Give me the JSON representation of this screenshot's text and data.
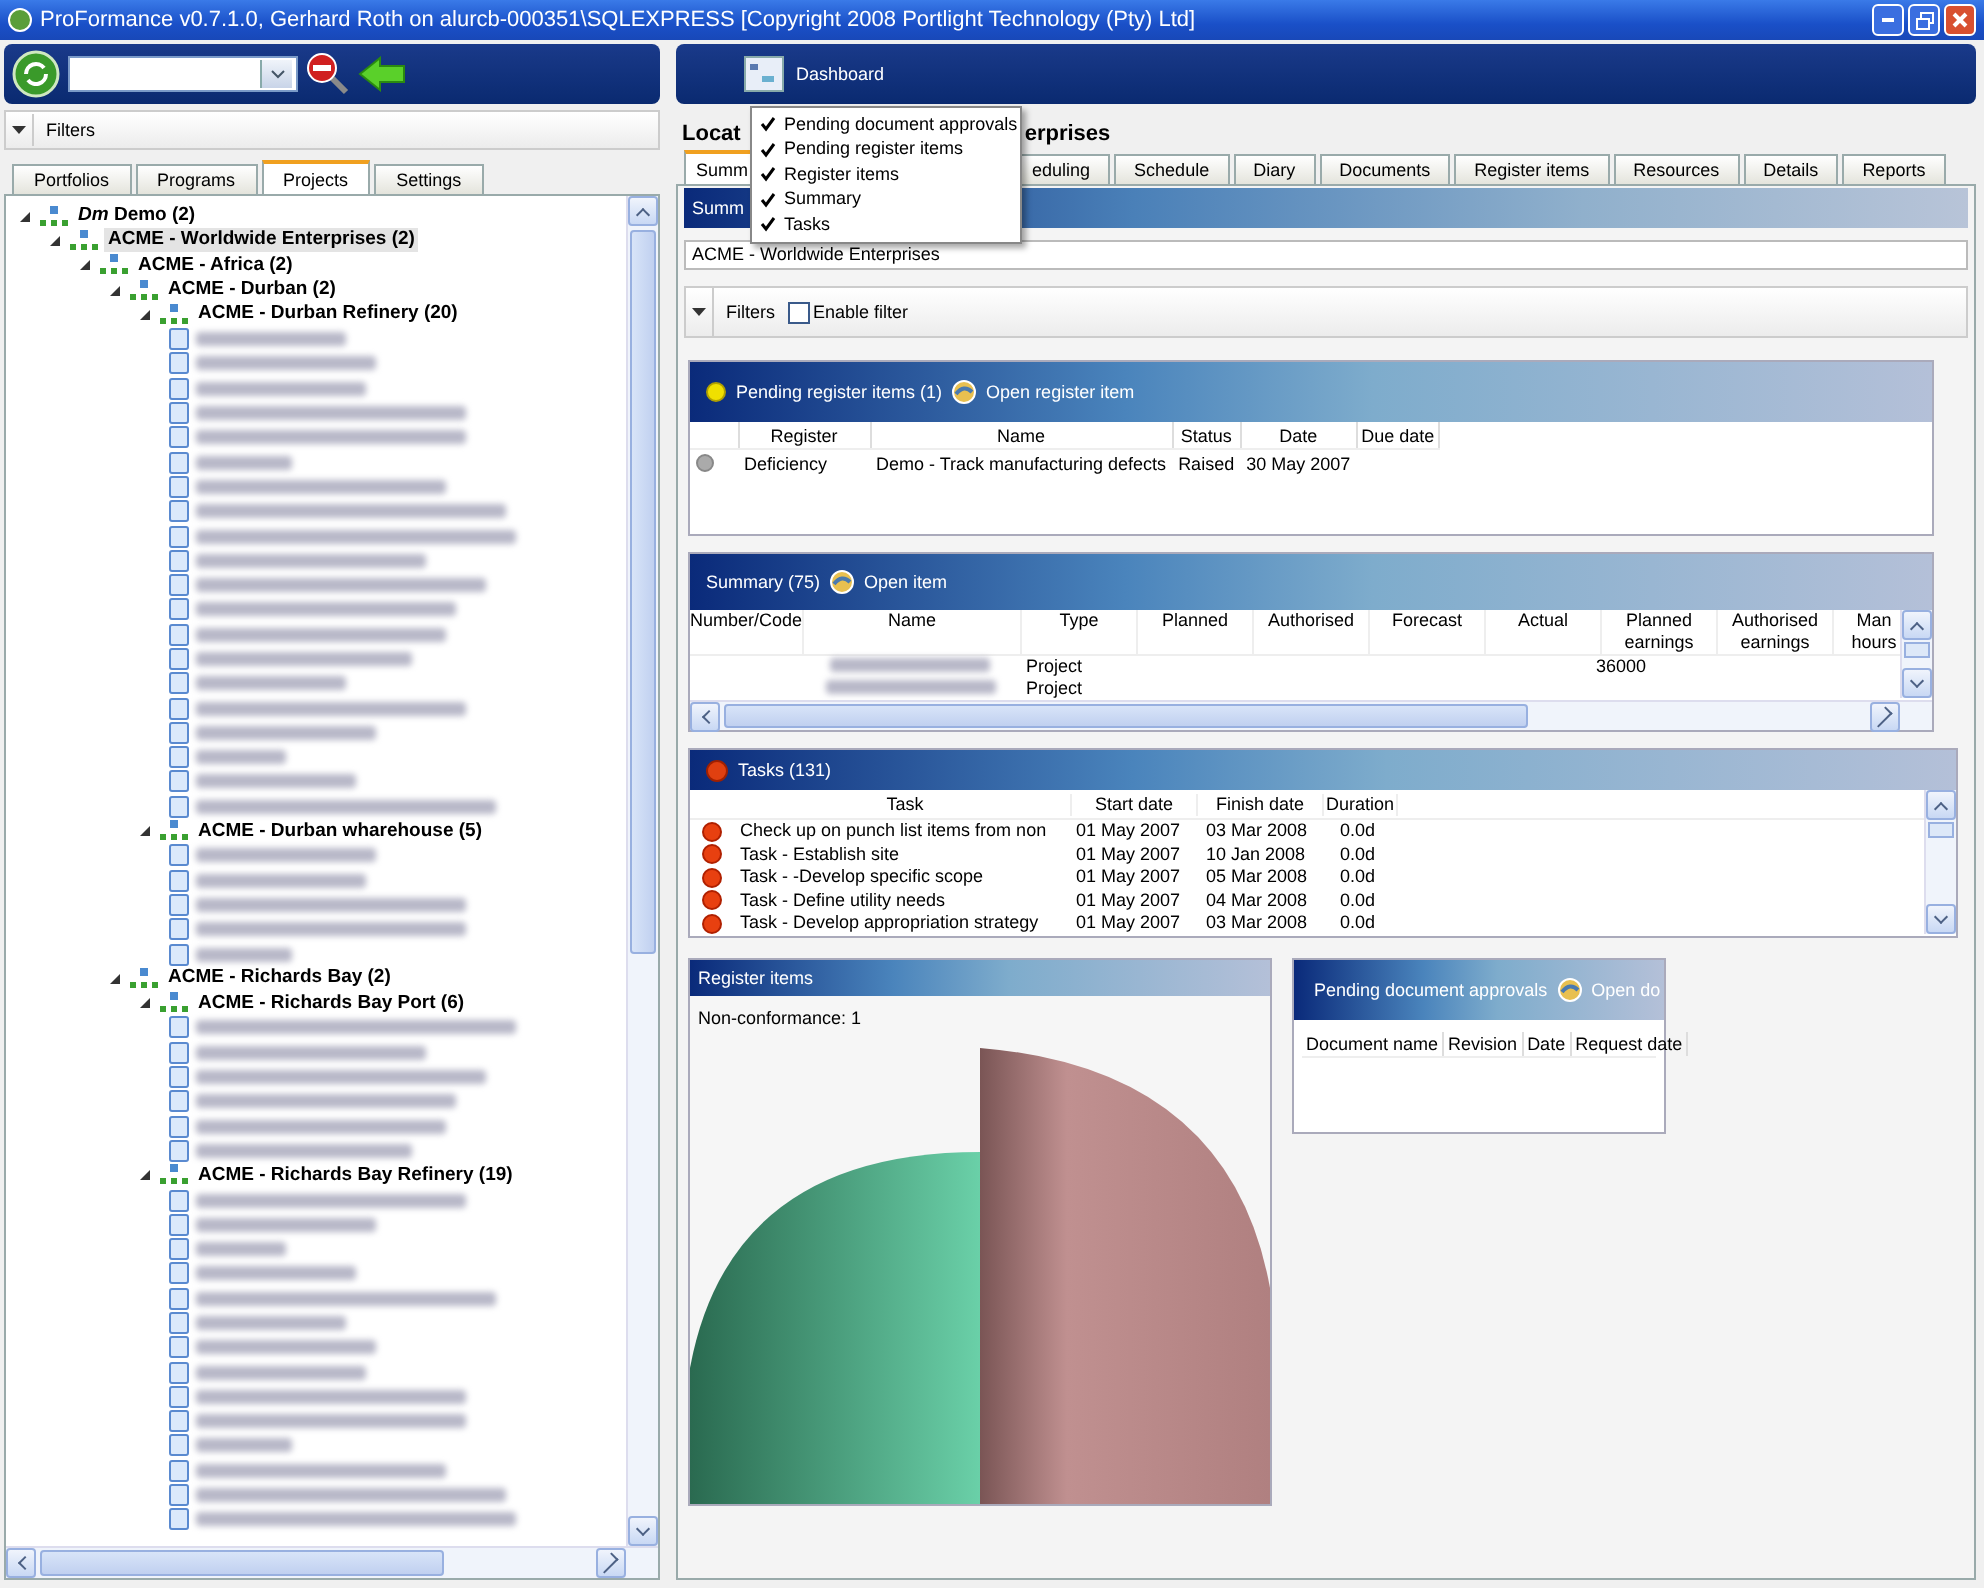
{
  "window": {
    "title": "ProFormance v0.7.1.0, Gerhard Roth on alurcb-000351\\SQLEXPRESS [Copyright 2008 Portlight Technology (Pty) Ltd]"
  },
  "left": {
    "filters_label": "Filters",
    "tabs": [
      {
        "label": "Portfolios",
        "selected": false
      },
      {
        "label": "Programs",
        "selected": false
      },
      {
        "label": "Projects",
        "selected": true
      },
      {
        "label": "Settings",
        "selected": false
      }
    ],
    "tree": [
      {
        "label": "*Dm* Demo (2)",
        "expanded": true,
        "selected": false,
        "children": [
          {
            "label": "ACME - Worldwide Enterprises (2)",
            "expanded": true,
            "selected": true,
            "children": [
              {
                "label": "ACME - Africa (2)",
                "expanded": true,
                "selected": false,
                "children": [
                  {
                    "label": "ACME - Durban (2)",
                    "expanded": true,
                    "selected": false,
                    "children": [
                      {
                        "label": "ACME - Durban Refinery (20)",
                        "expanded": true,
                        "selected": false,
                        "children": [
                          {
                            "kind": "redacted"
                          },
                          {
                            "kind": "redacted"
                          },
                          {
                            "kind": "redacted"
                          },
                          {
                            "kind": "redacted"
                          },
                          {
                            "kind": "redacted"
                          },
                          {
                            "kind": "redacted"
                          },
                          {
                            "kind": "redacted"
                          },
                          {
                            "kind": "redacted"
                          },
                          {
                            "kind": "redacted"
                          },
                          {
                            "kind": "redacted"
                          },
                          {
                            "kind": "redacted"
                          },
                          {
                            "kind": "redacted"
                          },
                          {
                            "kind": "redacted"
                          },
                          {
                            "kind": "redacted"
                          },
                          {
                            "kind": "redacted"
                          },
                          {
                            "kind": "redacted"
                          },
                          {
                            "kind": "redacted"
                          },
                          {
                            "kind": "redacted"
                          },
                          {
                            "kind": "redacted"
                          },
                          {
                            "kind": "redacted"
                          }
                        ]
                      },
                      {
                        "label": "ACME - Durban wharehouse (5)",
                        "expanded": true,
                        "selected": false,
                        "children": [
                          {
                            "kind": "redacted"
                          },
                          {
                            "kind": "redacted"
                          },
                          {
                            "kind": "redacted"
                          },
                          {
                            "kind": "redacted"
                          },
                          {
                            "kind": "redacted"
                          }
                        ]
                      }
                    ]
                  },
                  {
                    "label": "ACME - Richards Bay (2)",
                    "expanded": true,
                    "selected": false,
                    "children": [
                      {
                        "label": "ACME - Richards Bay Port (6)",
                        "expanded": true,
                        "selected": false,
                        "children": [
                          {
                            "kind": "redacted"
                          },
                          {
                            "kind": "redacted"
                          },
                          {
                            "kind": "redacted"
                          },
                          {
                            "kind": "redacted"
                          },
                          {
                            "kind": "redacted"
                          },
                          {
                            "kind": "redacted"
                          }
                        ]
                      },
                      {
                        "label": "ACME - Richards Bay Refinery (19)",
                        "expanded": true,
                        "selected": false,
                        "children": [
                          {
                            "kind": "redacted"
                          },
                          {
                            "kind": "redacted"
                          },
                          {
                            "kind": "redacted"
                          },
                          {
                            "kind": "redacted"
                          },
                          {
                            "kind": "redacted"
                          },
                          {
                            "kind": "redacted"
                          },
                          {
                            "kind": "redacted"
                          },
                          {
                            "kind": "redacted"
                          },
                          {
                            "kind": "redacted"
                          },
                          {
                            "kind": "redacted"
                          },
                          {
                            "kind": "redacted"
                          },
                          {
                            "kind": "redacted"
                          },
                          {
                            "kind": "redacted"
                          },
                          {
                            "kind": "redacted"
                          }
                        ]
                      }
                    ]
                  }
                ]
              }
            ]
          }
        ]
      }
    ]
  },
  "right": {
    "dashboard": "Dashboard",
    "menu": [
      {
        "label": "Pending document approvals",
        "checked": true
      },
      {
        "label": "Pending register items",
        "checked": true
      },
      {
        "label": "Register items",
        "checked": true
      },
      {
        "label": "Summary",
        "checked": true
      },
      {
        "label": "Tasks",
        "checked": true
      }
    ],
    "location_parts": [
      "Locat",
      "erprises"
    ],
    "tabs": [
      {
        "label": "Summ",
        "selected": true
      },
      {
        "label": "eduling",
        "selected": false
      },
      {
        "label": "Schedule",
        "selected": false
      },
      {
        "label": "Diary",
        "selected": false
      },
      {
        "label": "Documents",
        "selected": false
      },
      {
        "label": "Register items",
        "selected": false
      },
      {
        "label": "Resources",
        "selected": false
      },
      {
        "label": "Details",
        "selected": false
      },
      {
        "label": "Reports",
        "selected": false
      }
    ],
    "summary_bar": "Summ",
    "project_field": "ACME - Worldwide Enterprises",
    "filters": {
      "label": "Filters",
      "enable_filter": {
        "label": "Enable filter",
        "checked": false
      }
    },
    "pending_register": {
      "title": "Pending register items (1)",
      "action": "Open register item",
      "columns": [
        "Register",
        "Name",
        "Status",
        "Date",
        "Due date"
      ],
      "rows": [
        {
          "cells": [
            "Deficiency",
            "Demo - Track manufacturing defects",
            "Raised",
            "30 May 2007",
            ""
          ]
        }
      ]
    },
    "summary": {
      "title": "Summary (75)",
      "action": "Open item",
      "columns": [
        "Number/Code",
        "Name",
        "Type",
        "Planned",
        "Authorised",
        "Forecast",
        "Actual",
        "Planned earnings",
        "Authorised earnings",
        "Man hours"
      ],
      "rows": [
        {
          "type": "Project",
          "planned_earnings": "36000"
        },
        {
          "type": "Project",
          "planned_earnings": ""
        }
      ]
    },
    "tasks": {
      "title": "Tasks (131)",
      "columns": [
        "Task",
        "Start date",
        "Finish date",
        "Duration"
      ],
      "rows": [
        [
          "Check up on punch list items from non",
          "01 May 2007",
          "03 Mar 2008",
          "0.0d"
        ],
        [
          "Task - Establish site",
          "01 May 2007",
          "10 Jan 2008",
          "0.0d"
        ],
        [
          "Task - -Develop specific scope",
          "01 May 2007",
          "05 Mar 2008",
          "0.0d"
        ],
        [
          "Task - Define utility needs",
          "01 May 2007",
          "04 Mar 2008",
          "0.0d"
        ],
        [
          "Task - Develop appropriation strategy",
          "01 May 2007",
          "03 Mar 2008",
          "0.0d"
        ]
      ]
    },
    "register_chart": {
      "title": "Register items",
      "legend": "Non-conformance: 1"
    },
    "pending_docs": {
      "title": "Pending document approvals",
      "action": "Open do",
      "columns": [
        "Document name",
        "Revision",
        "Date",
        "Request date"
      ]
    }
  }
}
